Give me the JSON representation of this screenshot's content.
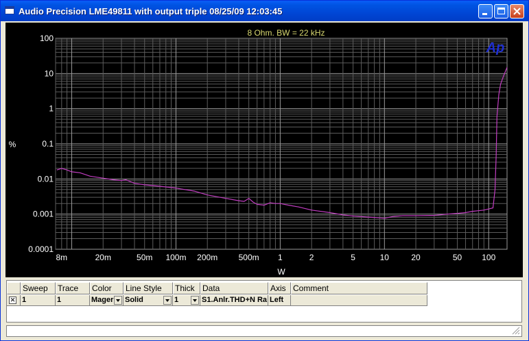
{
  "window": {
    "title": "Audio Precision  LME49811 with output triple  08/25/09 12:03:45"
  },
  "colors": {
    "background": "#000000",
    "grid_major": "#9a9a9a",
    "grid_minor": "#5c5c5c",
    "trace": "#c23ec2",
    "title_text": "#d8d870",
    "axis_text": "#ffffff",
    "logo": "#1f2fd0"
  },
  "chart_data": {
    "type": "line",
    "title": "8 Ohm. BW = 22 kHz",
    "xlabel": "W",
    "ylabel": "%",
    "xscale": "log",
    "yscale": "log",
    "xlim": [
      0.007,
      150
    ],
    "ylim": [
      0.0001,
      100
    ],
    "grid": true,
    "x_ticks": [
      {
        "v": 0.008,
        "label": "8m"
      },
      {
        "v": 0.02,
        "label": "20m"
      },
      {
        "v": 0.05,
        "label": "50m"
      },
      {
        "v": 0.1,
        "label": "100m"
      },
      {
        "v": 0.2,
        "label": "200m"
      },
      {
        "v": 0.5,
        "label": "500m"
      },
      {
        "v": 1,
        "label": "1"
      },
      {
        "v": 2,
        "label": "2"
      },
      {
        "v": 5,
        "label": "5"
      },
      {
        "v": 10,
        "label": "10"
      },
      {
        "v": 20,
        "label": "20"
      },
      {
        "v": 50,
        "label": "50"
      },
      {
        "v": 100,
        "label": "100"
      }
    ],
    "y_ticks": [
      {
        "v": 100,
        "label": "100"
      },
      {
        "v": 10,
        "label": "10"
      },
      {
        "v": 1,
        "label": "1"
      },
      {
        "v": 0.1,
        "label": "0.1"
      },
      {
        "v": 0.01,
        "label": "0.01"
      },
      {
        "v": 0.001,
        "label": "0.001"
      },
      {
        "v": 0.0001,
        "label": "0.0001"
      }
    ],
    "series": [
      {
        "color": "#c23ec2",
        "x": [
          0.0072,
          0.008,
          0.009,
          0.01,
          0.012,
          0.015,
          0.02,
          0.025,
          0.03,
          0.033,
          0.04,
          0.05,
          0.07,
          0.1,
          0.15,
          0.2,
          0.3,
          0.4,
          0.45,
          0.5,
          0.55,
          0.6,
          0.7,
          0.8,
          0.9,
          1,
          1.2,
          1.5,
          2,
          3,
          4,
          5,
          6,
          7,
          8,
          9,
          10,
          12,
          15,
          20,
          30,
          40,
          50,
          60,
          70,
          80,
          90,
          100,
          110,
          115,
          118,
          120,
          125,
          130,
          140,
          150
        ],
        "y": [
          0.018,
          0.02,
          0.018,
          0.016,
          0.015,
          0.012,
          0.0105,
          0.0095,
          0.009,
          0.0095,
          0.0075,
          0.0068,
          0.0062,
          0.0055,
          0.0045,
          0.0035,
          0.0028,
          0.0024,
          0.0023,
          0.0028,
          0.0022,
          0.0019,
          0.0018,
          0.0021,
          0.002,
          0.002,
          0.0018,
          0.0016,
          0.0013,
          0.0011,
          0.00095,
          0.00088,
          0.00085,
          0.00082,
          0.0008,
          0.00078,
          0.00076,
          0.00085,
          0.0009,
          0.0009,
          0.00092,
          0.001,
          0.00105,
          0.0011,
          0.0012,
          0.00125,
          0.0013,
          0.0014,
          0.0015,
          0.005,
          0.05,
          0.6,
          2.5,
          5,
          9,
          15
        ]
      }
    ]
  },
  "table": {
    "headers": [
      "Sweep",
      "Trace",
      "Color",
      "Line Style",
      "Thick",
      "Data",
      "Axis",
      "Comment"
    ],
    "row": {
      "checked": "✕",
      "sweep": "1",
      "trace": "1",
      "color": "Mager",
      "line_style": "Solid",
      "thick": "1",
      "data": "S1.Anlr.THD+N Ra",
      "axis": "Left",
      "comment": ""
    }
  },
  "logo_text": "Ap"
}
